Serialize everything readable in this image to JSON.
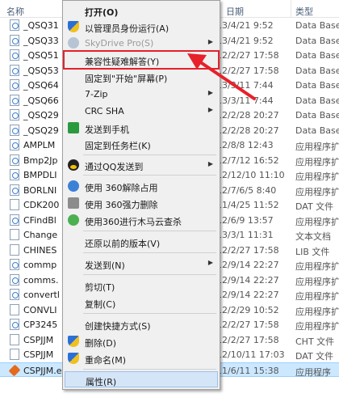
{
  "columns": {
    "name": "名称",
    "date": "日期",
    "type": "类型"
  },
  "files": [
    {
      "name": "_QSQ31",
      "date": "2013/4/21 9:52",
      "type": "Data Base",
      "icon": "app"
    },
    {
      "name": "_QSQ33",
      "date": "2013/4/21 9:52",
      "type": "Data Base",
      "icon": "app"
    },
    {
      "name": "_QSQ51",
      "date": "2012/2/27 17:58",
      "type": "Data Base",
      "icon": "app"
    },
    {
      "name": "_QSQ53",
      "date": "2012/2/27 17:58",
      "type": "Data Base",
      "icon": "app"
    },
    {
      "name": "_QSQ64",
      "date": "2013/3/11 7:44",
      "type": "Data Base",
      "icon": "app"
    },
    {
      "name": "_QSQ66",
      "date": "2013/3/11 7:44",
      "type": "Data Base",
      "icon": "app"
    },
    {
      "name": "_QSQ29",
      "date": "2012/2/28 20:27",
      "type": "Data Base",
      "icon": "app"
    },
    {
      "name": "_QSQ29",
      "date": "2012/2/28 20:27",
      "type": "Data Base",
      "icon": "app"
    },
    {
      "name": "AMPLM",
      "date": "2012/8/8 12:43",
      "type": "应用程序扩",
      "icon": "app"
    },
    {
      "name": "Bmp2Jp",
      "date": "2012/7/12 16:52",
      "type": "应用程序扩",
      "icon": "app"
    },
    {
      "name": "BMPDLI",
      "date": "2012/12/10 11:10",
      "type": "应用程序扩",
      "icon": "app"
    },
    {
      "name": "BORLNI",
      "date": "2012/7/6/5 8:40",
      "type": "应用程序扩",
      "icon": "app"
    },
    {
      "name": "CDK200",
      "date": "2011/4/25 11:52",
      "type": "DAT 文件",
      "icon": "doc"
    },
    {
      "name": "CFindBl",
      "date": "2012/6/9 13:57",
      "type": "应用程序扩",
      "icon": "app"
    },
    {
      "name": "Change",
      "date": "2013/3/1 11:31",
      "type": "文本文档",
      "icon": "doc"
    },
    {
      "name": "CHINES",
      "date": "2012/2/27 17:58",
      "type": "LIB 文件",
      "icon": "doc"
    },
    {
      "name": "commp",
      "date": "2012/9/14 22:27",
      "type": "应用程序扩",
      "icon": "app"
    },
    {
      "name": "comms.",
      "date": "2012/9/14 22:27",
      "type": "应用程序扩",
      "icon": "app"
    },
    {
      "name": "convertl",
      "date": "2012/9/14 22:27",
      "type": "应用程序扩",
      "icon": "app"
    },
    {
      "name": "CONVLI",
      "date": "2012/2/29 10:52",
      "type": "应用程序扩",
      "icon": "doc"
    },
    {
      "name": "CP3245",
      "date": "2012/2/27 17:58",
      "type": "应用程序扩",
      "icon": "app"
    },
    {
      "name": "CSPJJM",
      "date": "2012/2/27 17:58",
      "type": "CHT 文件",
      "icon": "doc"
    },
    {
      "name": "CSPJJM",
      "date": "2012/10/11 17:03",
      "type": "DAT 文件",
      "icon": "doc"
    },
    {
      "name": "CSPJJM.exe",
      "date": "2011/6/11 15:38",
      "type": "应用程序",
      "icon": "box",
      "selected": true
    }
  ],
  "menu": {
    "open": "打开(O)",
    "run_as_admin": "以管理员身份运行(A)",
    "skydrive": "SkyDrive Pro(S)",
    "compat": "兼容性疑难解答(Y)",
    "pin_start": "固定到\"开始\"屏幕(P)",
    "zip": "7-Zip",
    "crc": "CRC SHA",
    "send_phone": "发送到手机",
    "pin_taskbar": "固定到任务栏(K)",
    "send_qq": "通过QQ发送到",
    "unlock360": "使用 360解除占用",
    "delete360": "使用 360强力删除",
    "scan360": "使用360进行木马云查杀",
    "restore": "还原以前的版本(V)",
    "send_to": "发送到(N)",
    "cut": "剪切(T)",
    "copy": "复制(C)",
    "shortcut": "创建快捷方式(S)",
    "delete": "删除(D)",
    "rename": "重命名(M)",
    "properties": "属性(R)"
  },
  "colors": {
    "highlight_box": "#e6212a",
    "arrow": "#e6212a",
    "selected_row": "#cce8ff"
  }
}
